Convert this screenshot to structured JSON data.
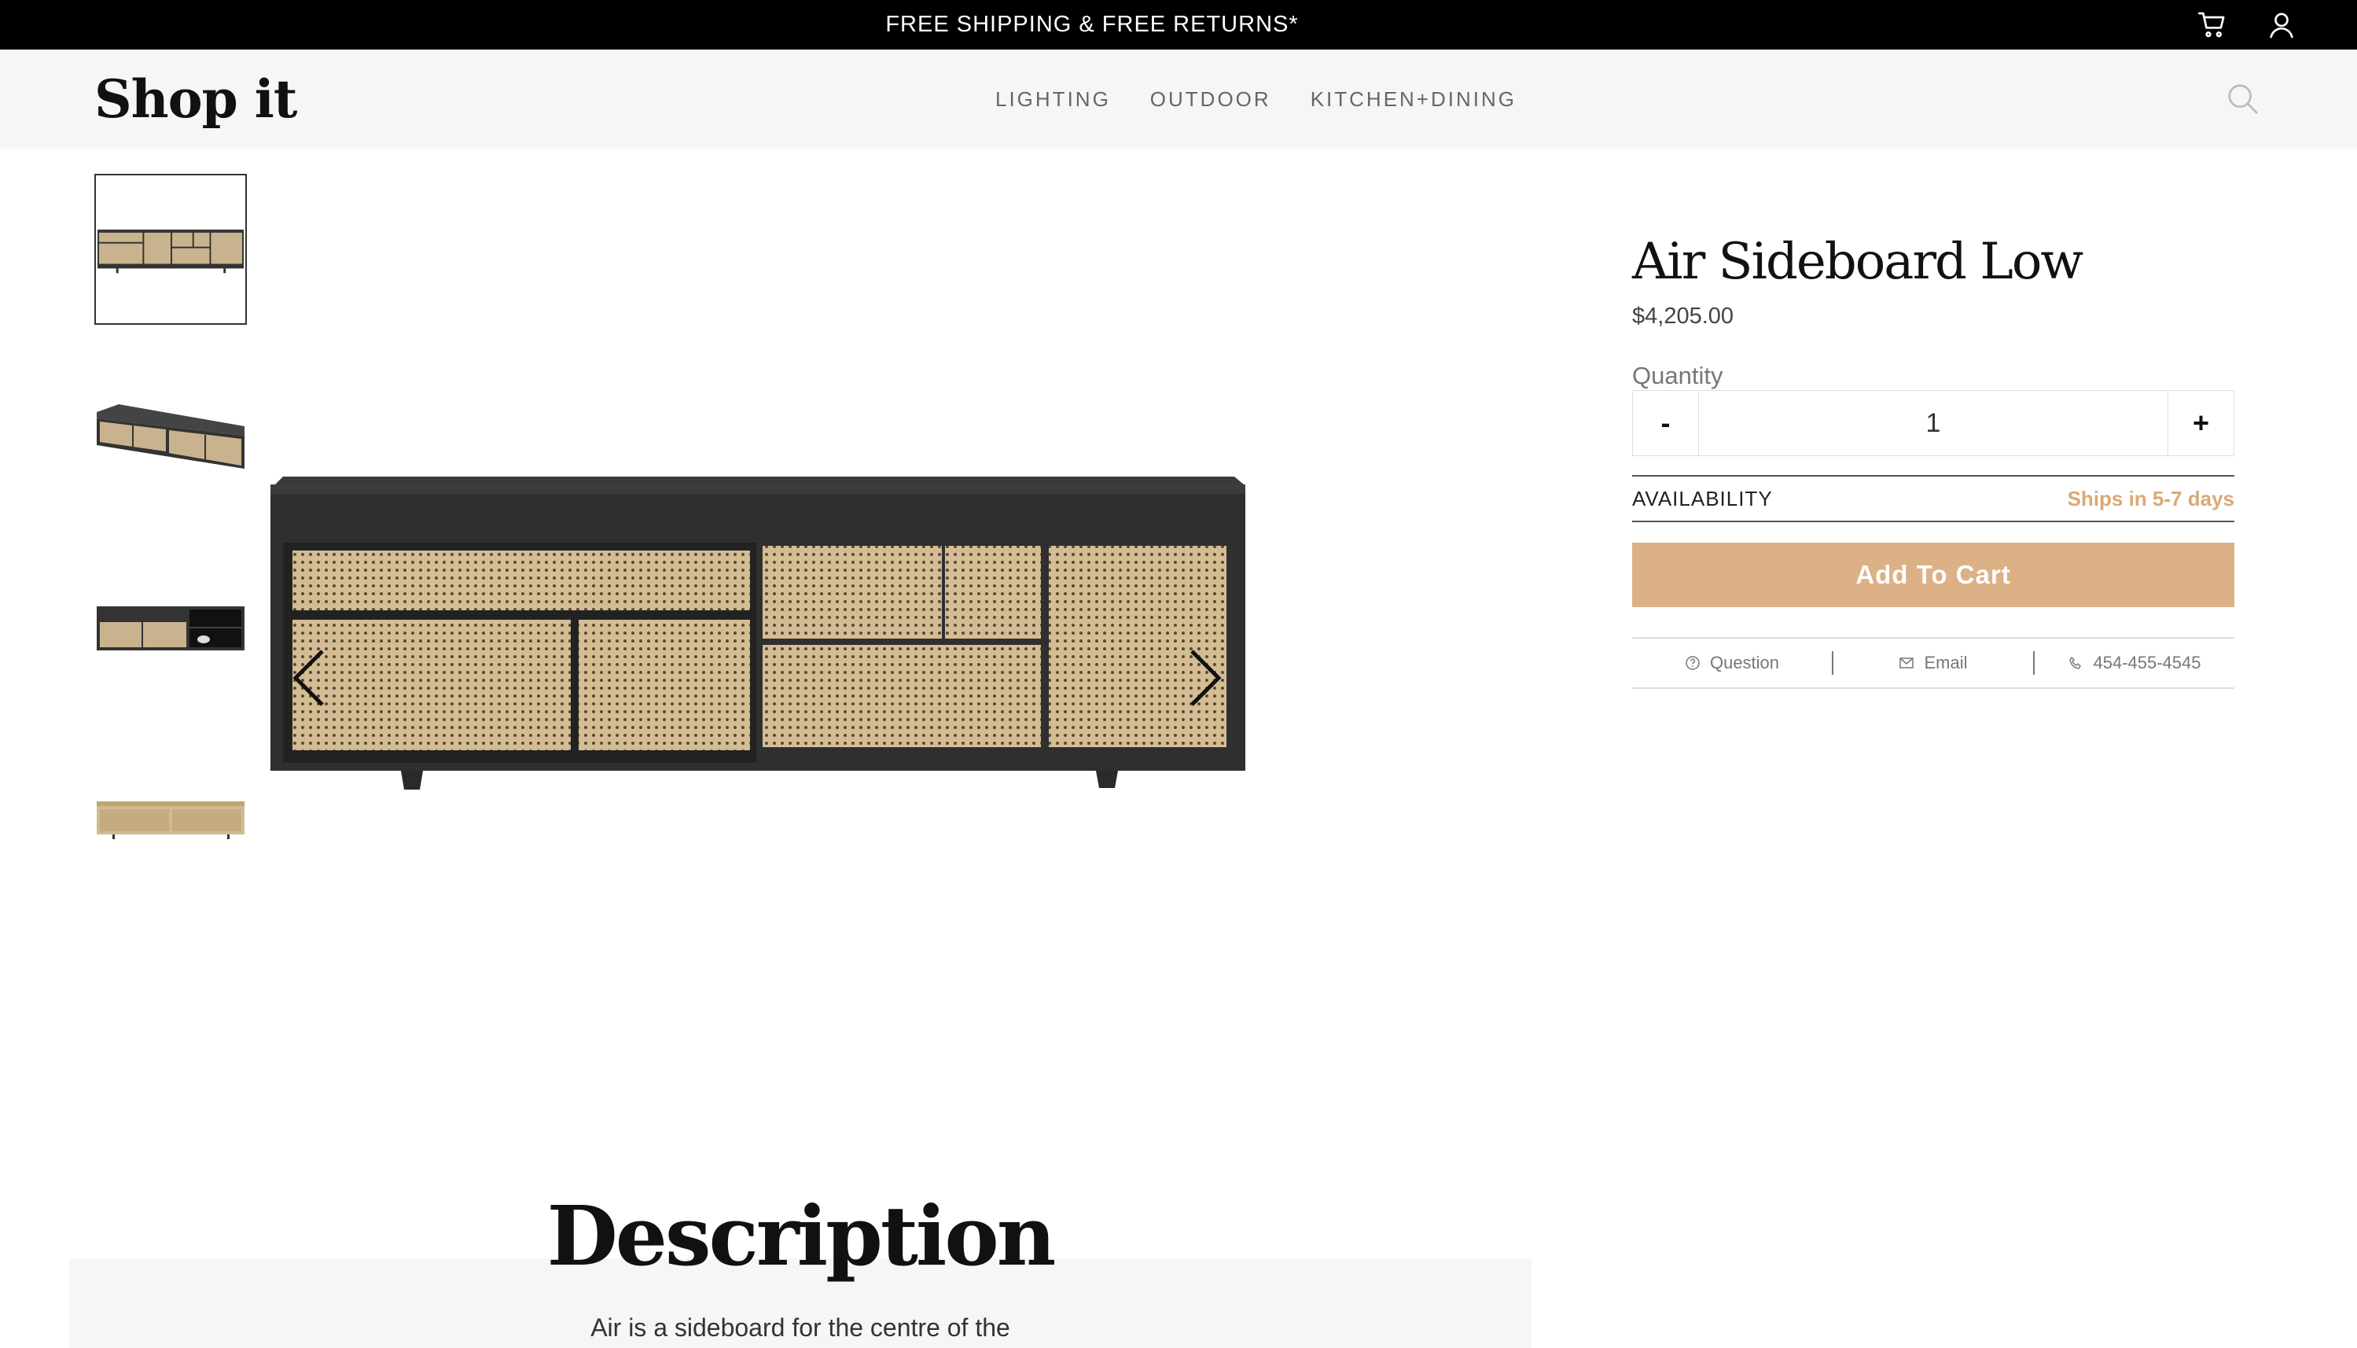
{
  "announcement": "FREE SHIPPING & FREE RETURNS*",
  "brand": "Shop it",
  "nav": {
    "items": [
      "LIGHTING",
      "OUTDOOR",
      "KITCHEN+DINING"
    ]
  },
  "icons": {
    "cart": "cart-icon",
    "user": "user-icon",
    "search": "search-icon",
    "prev": "chevron-left-icon",
    "next": "chevron-right-icon"
  },
  "gallery": {
    "thumbnail_count": 4,
    "active_index": 0
  },
  "product": {
    "title": "Air Sideboard Low",
    "price": "$4,205.00",
    "quantity_label": "Quantity",
    "quantity_minus": "-",
    "quantity_value": "1",
    "quantity_plus": "+",
    "availability_label": "AVAILABILITY",
    "availability_value": "Ships in 5-7 days",
    "add_to_cart": "Add To Cart"
  },
  "contact": {
    "question": "Question",
    "email": "Email",
    "phone": "454-455-4545"
  },
  "description": {
    "title": "Description",
    "text": "Air is a sideboard for the centre of the"
  },
  "colors": {
    "accent": "#dbb185",
    "availability": "#d9a975",
    "topbar": "#000000",
    "header_bg": "#f6f6f6"
  }
}
